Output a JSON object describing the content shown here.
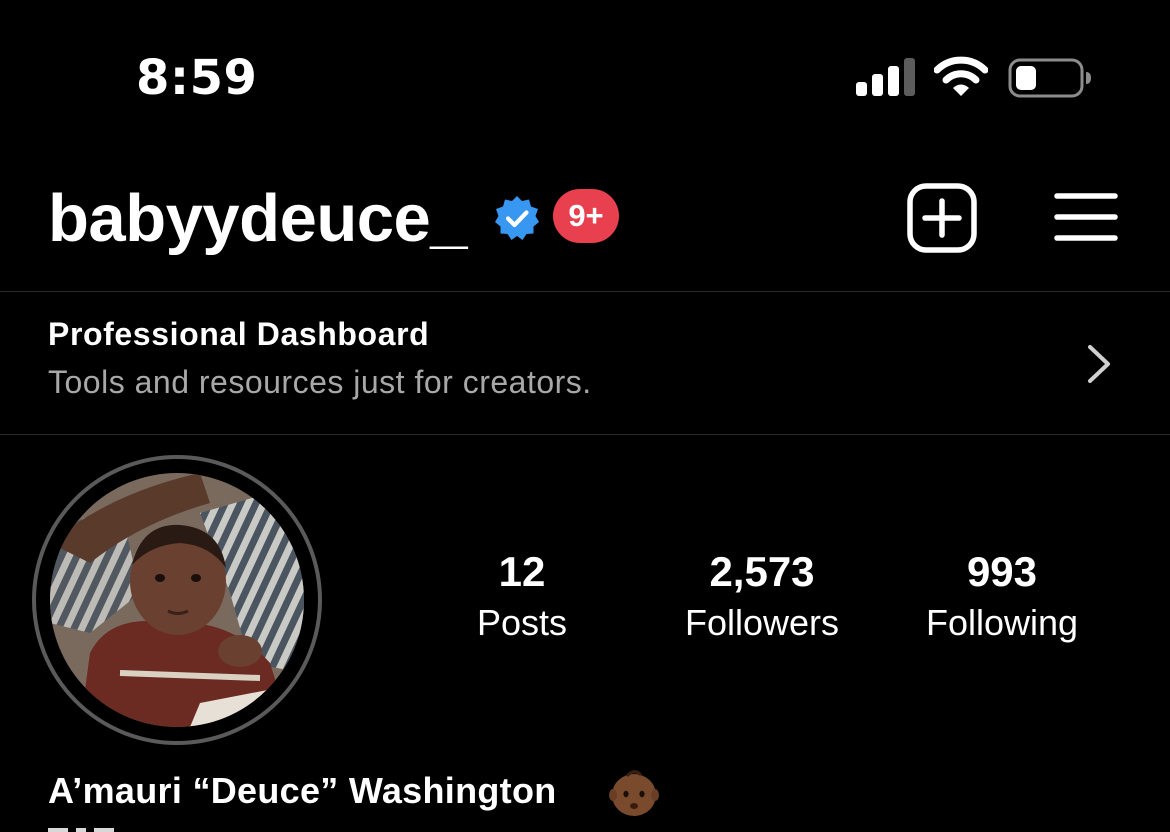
{
  "status_bar": {
    "time": "8:59",
    "signal_icon": "cellular-signal-icon",
    "wifi_icon": "wifi-icon",
    "battery_icon": "battery-low-icon"
  },
  "header": {
    "username": "babyydeuce_",
    "verified_icon": "verified-badge-icon",
    "notification_badge": "9+",
    "new_post_icon": "plus-square-icon",
    "menu_icon": "hamburger-menu-icon"
  },
  "dashboard": {
    "title": "Professional Dashboard",
    "subtitle": "Tools and resources just for creators.",
    "chevron_icon": "chevron-right-icon"
  },
  "profile": {
    "avatar": "profile-photo",
    "stats": {
      "posts": {
        "value": "12",
        "label": "Posts"
      },
      "followers": {
        "value": "2,573",
        "label": "Followers"
      },
      "following": {
        "value": "993",
        "label": "Following"
      }
    },
    "full_name": "A’mauri “Deuce” Washington",
    "name_emoji": "baby-emoji"
  },
  "colors": {
    "background": "#000000",
    "text": "#ffffff",
    "secondary_text": "#a8a8a8",
    "verified_blue": "#3897f0",
    "badge_red": "#e8404f",
    "divider": "#2a2a2a"
  }
}
